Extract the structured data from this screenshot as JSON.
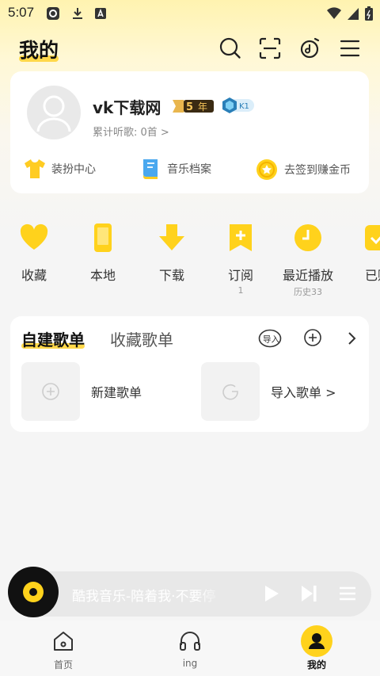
{
  "status_bar": {
    "time": "5:07"
  },
  "header": {
    "title": "我的"
  },
  "profile": {
    "username": "vk下载网",
    "badge_years": "年",
    "badge_years_num": "5",
    "badge_level": "K1",
    "listen_count": "累计听歌: 0首 >"
  },
  "quick_links": [
    {
      "label": "装扮中心",
      "icon": "shirt-icon"
    },
    {
      "label": "音乐档案",
      "icon": "book-icon"
    },
    {
      "label": "去签到赚金币",
      "icon": "coin-icon"
    }
  ],
  "features": [
    {
      "label": "收藏",
      "sub": "",
      "icon": "heart-icon"
    },
    {
      "label": "本地",
      "sub": "",
      "icon": "phone-icon"
    },
    {
      "label": "下载",
      "sub": "",
      "icon": "download-icon"
    },
    {
      "label": "订阅",
      "sub": "1",
      "icon": "subscribe-icon"
    },
    {
      "label": "最近播放",
      "sub": "历史33",
      "icon": "clock-icon"
    },
    {
      "label": "已购",
      "sub": "",
      "icon": "purchased-icon"
    }
  ],
  "playlists": {
    "tab_active": "自建歌单",
    "tab_other": "收藏歌单",
    "import_badge": "导入",
    "items": [
      {
        "label": "新建歌单"
      },
      {
        "label": "导入歌单 >"
      }
    ]
  },
  "mini_player": {
    "title": "酷我音乐-陪着我·不要停"
  },
  "bottom_nav": [
    {
      "label": "首页",
      "icon": "home-icon"
    },
    {
      "label": "ing",
      "icon": "headphones-icon"
    },
    {
      "label": "我的",
      "icon": "profile-icon"
    }
  ],
  "colors": {
    "accent": "#ffd21c",
    "background": "#f5f5f5",
    "card": "#ffffff"
  }
}
